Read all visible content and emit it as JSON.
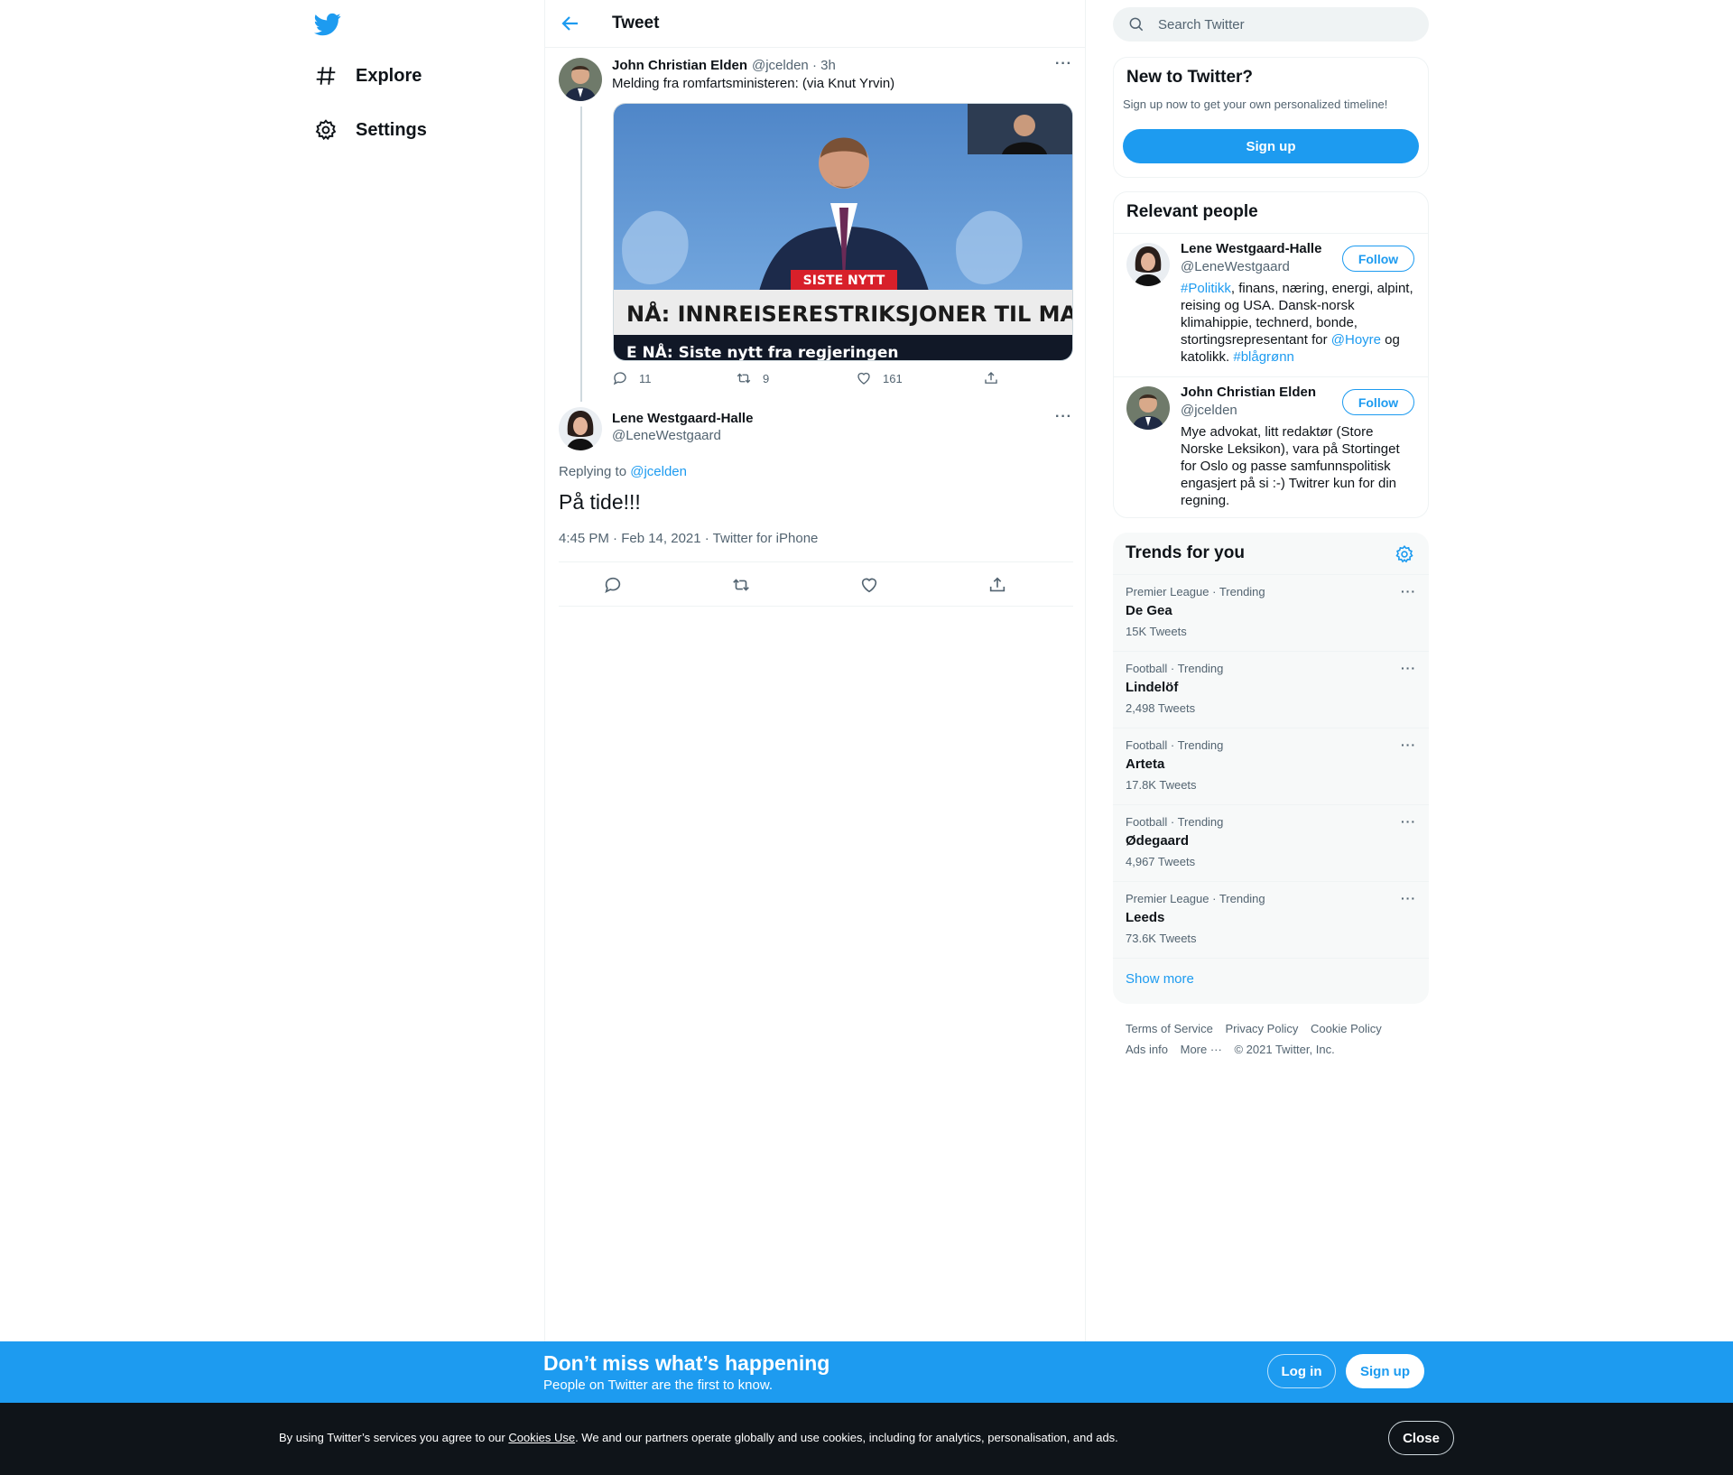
{
  "nav": {
    "logo_icon": "twitter-bird-icon",
    "items": [
      {
        "label": "Explore",
        "icon": "hashtag-icon"
      },
      {
        "label": "Settings",
        "icon": "gear-icon"
      }
    ]
  },
  "header": {
    "title": "Tweet"
  },
  "parent_tweet": {
    "name": "John Christian Elden",
    "handle": "@jcelden",
    "time": "· 3h",
    "text": "Melding fra romfartsministeren: (via Knut Yrvin)",
    "media": {
      "badge": "SISTE NYTT",
      "headline": "NÅ: INNREISERESTRIKSJONER TIL MARS",
      "ticker": "E NÅ: Siste nytt fra regjeringen"
    },
    "replies": "11",
    "retweets": "9",
    "likes": "161"
  },
  "focal_tweet": {
    "name": "Lene Westgaard-Halle",
    "handle": "@LeneWestgaard",
    "replying_prefix": "Replying to ",
    "replying_to": "@jcelden",
    "text": "På tide!!!",
    "meta": "4:45 PM · Feb 14, 2021 · Twitter for iPhone"
  },
  "search": {
    "placeholder": "Search Twitter"
  },
  "new_to_twitter": {
    "title": "New to Twitter?",
    "subtitle": "Sign up now to get your own personalized timeline!",
    "button": "Sign up"
  },
  "relevant": {
    "title": "Relevant people",
    "people": [
      {
        "name": "Lene Westgaard-Halle",
        "handle": "@LeneWestgaard",
        "follow": "Follow",
        "bio_parts": [
          "#Politikk",
          ", finans, næring, energi, alpint, reising og USA. Dansk-norsk klimahippie, technerd, bonde, stortingsrepresentant for ",
          "@Hoyre",
          " og katolikk. ",
          "#blågrønn"
        ]
      },
      {
        "name": "John Christian Elden",
        "handle": "@jcelden",
        "follow": "Follow",
        "bio": "Mye advokat, litt redaktør (Store Norske Leksikon), vara på Stortinget for Oslo og passe samfunnspolitisk engasjert på si :-) Twitrer kun for din regning."
      }
    ]
  },
  "trends": {
    "title": "Trends for you",
    "items": [
      {
        "context": "Premier League · Trending",
        "name": "De Gea",
        "count": "15K Tweets"
      },
      {
        "context": "Football · Trending",
        "name": "Lindelöf",
        "count": "2,498 Tweets"
      },
      {
        "context": "Football · Trending",
        "name": "Arteta",
        "count": "17.8K Tweets"
      },
      {
        "context": "Football · Trending",
        "name": "Ødegaard",
        "count": "4,967 Tweets"
      },
      {
        "context": "Premier League · Trending",
        "name": "Leeds",
        "count": "73.6K Tweets"
      }
    ],
    "show_more": "Show more"
  },
  "footer": {
    "links": [
      "Terms of Service",
      "Privacy Policy",
      "Cookie Policy",
      "Ads info",
      "More ···",
      "© 2021 Twitter, Inc."
    ]
  },
  "bottom_bar": {
    "title": "Don’t miss what’s happening",
    "subtitle": "People on Twitter are the first to know.",
    "login": "Log in",
    "signup": "Sign up"
  },
  "cookie": {
    "prefix": "By using Twitter’s services you agree to our ",
    "link": "Cookies Use",
    "suffix": ". We and our partners operate globally and use cookies, including for analytics, personalisation, and ads.",
    "close": "Close"
  },
  "colors": {
    "accent": "#1d9bf0",
    "text": "#0f1419",
    "muted": "#536471",
    "dark_bar": "#0f1419"
  }
}
